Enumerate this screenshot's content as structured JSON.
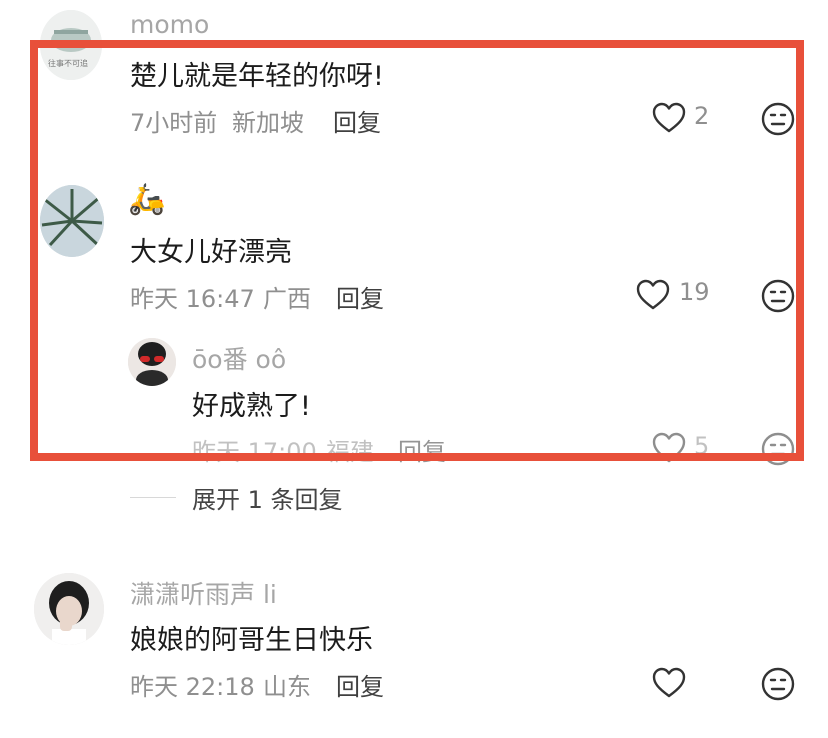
{
  "comments": [
    {
      "username": "momo",
      "text": "楚儿就是年轻的你呀!",
      "time": "7小时前",
      "location": "新加坡",
      "reply_label": "回复",
      "likes": "2",
      "avatar_caption": "往事不可追"
    },
    {
      "username": "🛵",
      "text": "大女儿好漂亮",
      "time": "昨天 16:47",
      "location": "广西",
      "reply_label": "回复",
      "likes": "19"
    },
    {
      "username": "ōo番 oô",
      "text": "好成熟了!",
      "time": "昨天 17:00",
      "location": "福建",
      "reply_label": "回复",
      "likes": "5",
      "is_reply": true
    },
    {
      "username": "潇潇听雨声 li",
      "text": "娘娘的阿哥生日快乐",
      "time": "昨天 22:18",
      "location": "山东",
      "reply_label": "回复",
      "likes": ""
    }
  ],
  "expand_replies": "展开 1 条回复",
  "colors": {
    "highlight_border": "#e8503a",
    "meta_text": "#8f8f8f",
    "username_text": "#a6a6a6"
  },
  "icons": [
    "heart-icon",
    "emoji-face-icon"
  ]
}
